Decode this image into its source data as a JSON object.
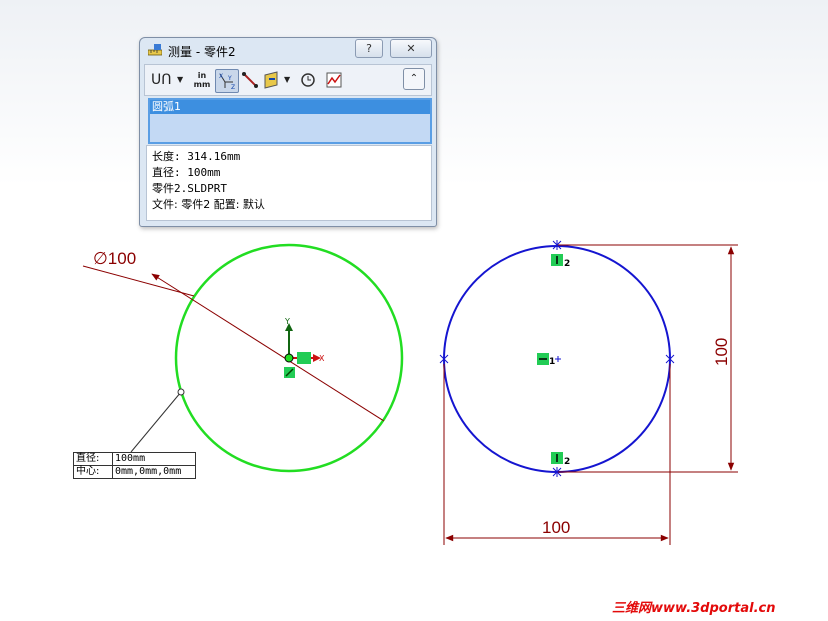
{
  "dialog": {
    "title": "测量 - 零件2",
    "help_label": "?",
    "close_label": "✕",
    "tools": {
      "units_top": "in",
      "units_bottom": "mm",
      "collapse_label": "⌃"
    },
    "selection": [
      "圆弧1"
    ],
    "results": {
      "length": "长度: 314.16mm",
      "diameter": "直径: 100mm",
      "part": "零件2.SLDPRT",
      "file": "文件:  零件2 配置:  默认"
    }
  },
  "drawing": {
    "diameter_dim": "∅100",
    "horizontal_dim": "100",
    "vertical_dim": "100",
    "callout": {
      "diameter_label": "直径:",
      "diameter_value": "100mm",
      "center_label": "中心:",
      "center_value": "0mm,0mm,0mm"
    },
    "triad_x": "X",
    "triad_y": "Y",
    "relation_1": "1",
    "relation_2_top": "2",
    "relation_2_bottom": "2"
  },
  "colors": {
    "green_circle": "#22dd22",
    "blue_circle": "#1515d0",
    "dimension": "#8b0000",
    "watermark": "#e30a0a"
  },
  "watermark": "三维网www.3dportal.cn"
}
